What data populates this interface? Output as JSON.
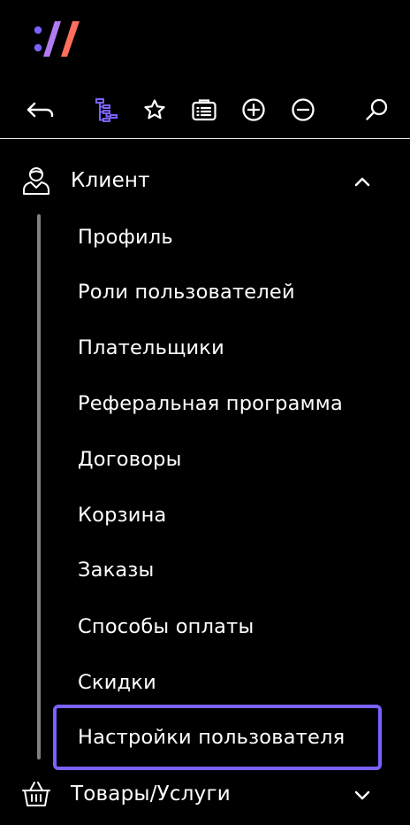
{
  "colors": {
    "background": "#000000",
    "accent": "#7b61ff",
    "text": "#ffffff",
    "tree_line": "#808080"
  },
  "logo": {
    "icon": "brand-logo-icon"
  },
  "toolbar": {
    "buttons": [
      {
        "name": "back",
        "icon": "back-arrow-icon"
      },
      {
        "name": "tree",
        "icon": "tree-structure-icon",
        "active": true
      },
      {
        "name": "favorites",
        "icon": "star-icon"
      },
      {
        "name": "list",
        "icon": "briefcase-list-icon"
      },
      {
        "name": "expand-all",
        "icon": "plus-circle-icon"
      },
      {
        "name": "collapse-all",
        "icon": "minus-circle-icon"
      },
      {
        "name": "search",
        "icon": "search-icon"
      }
    ]
  },
  "sections": {
    "client": {
      "label": "Клиент",
      "icon": "user-icon",
      "expanded": true,
      "items": [
        "Профиль",
        "Роли пользователей",
        "Плательщики",
        "Реферальная программа",
        "Договоры",
        "Корзина",
        "Заказы",
        "Способы оплаты",
        "Скидки",
        "Настройки пользователя"
      ],
      "active_item": "Настройки пользователя"
    },
    "goods": {
      "label": "Товары/Услуги",
      "icon": "basket-icon",
      "expanded": false
    }
  }
}
